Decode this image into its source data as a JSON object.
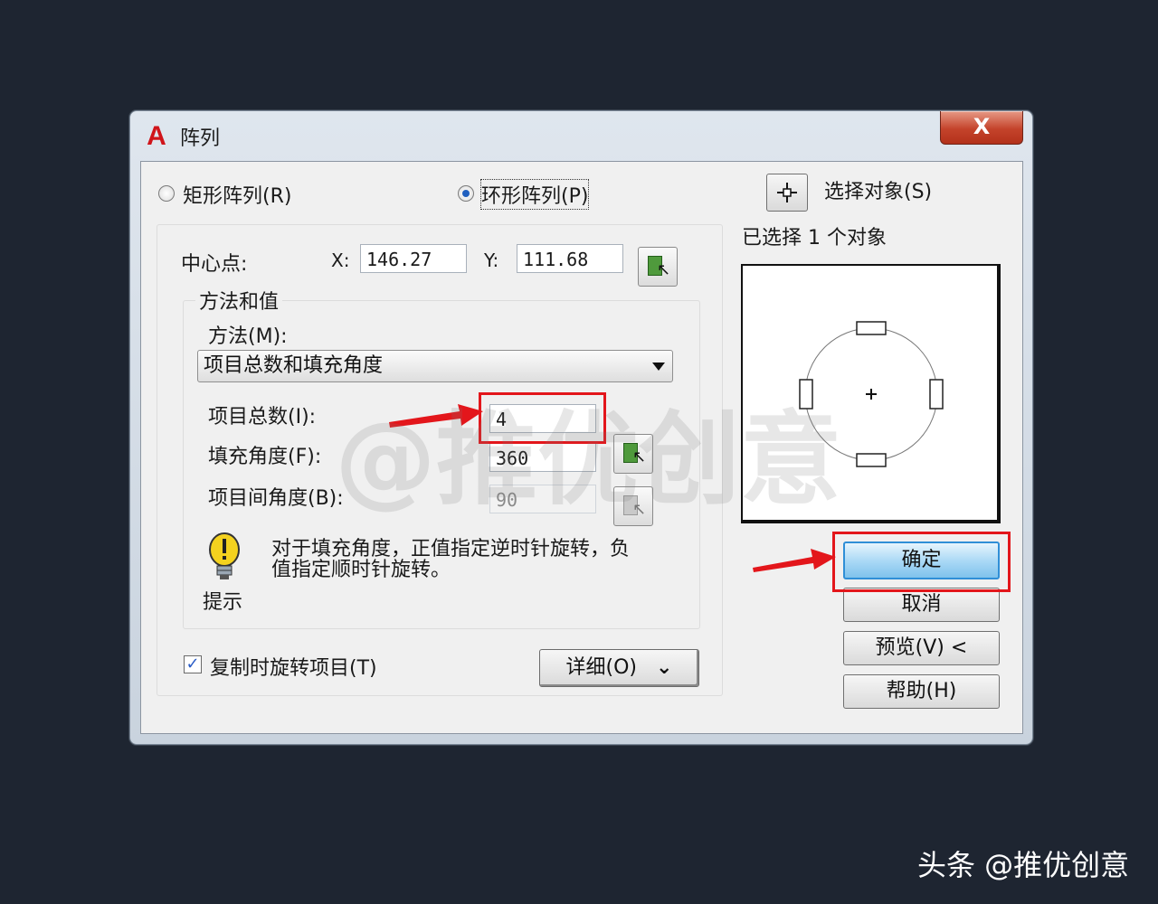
{
  "window": {
    "app_logo": "A",
    "title": "阵列",
    "close_glyph": "X"
  },
  "array_type": {
    "rect_label": "矩形阵列(R)",
    "polar_label": "环形阵列(P)",
    "selected": "polar"
  },
  "center_point": {
    "label": "中心点:",
    "x_label": "X:",
    "x_value": "146.27",
    "y_label": "Y:",
    "y_value": "111.68"
  },
  "method_group": {
    "title": "方法和值",
    "method_label": "方法(M):",
    "method_value": "项目总数和填充角度",
    "total_items_label": "项目总数(I):",
    "total_items_value": "4",
    "fill_angle_label": "填充角度(F):",
    "fill_angle_value": "360",
    "item_angle_label": "项目间角度(B):",
    "item_angle_value": "90",
    "tip_text_1": "对于填充角度，正值指定逆时针旋转，负",
    "tip_text_2": "值指定顺时针旋转。",
    "tip_label": "提示"
  },
  "options": {
    "rotate_checkbox_label": "复制时旋转项目(T)",
    "rotate_checked": true,
    "details_label": "详细(O)",
    "details_chevron": "⌄"
  },
  "selection": {
    "select_objects_label": "选择对象(S)",
    "selected_count_text": "已选择 1 个对象"
  },
  "buttons": {
    "ok": "确定",
    "cancel": "取消",
    "preview": "预览(V) <",
    "help": "帮助(H)"
  },
  "overlay": {
    "watermark": "@推优创意",
    "credit": "头条 @推优创意",
    "highlight_color": "#e3161b"
  }
}
